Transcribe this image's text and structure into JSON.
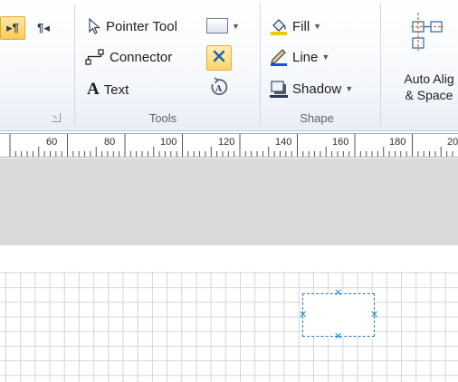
{
  "ribbon": {
    "paragraph": {
      "ltr_label": "▸¶",
      "rtl_label": "¶◂"
    },
    "tools": {
      "group_label": "Tools",
      "pointer_tool_label": "Pointer Tool",
      "connector_label": "Connector",
      "text_label": "Text"
    },
    "shape": {
      "group_label": "Shape",
      "fill_label": "Fill",
      "line_label": "Line",
      "shadow_label": "Shadow"
    },
    "arrange": {
      "auto_align_label_line1": "Auto Alig",
      "auto_align_label_line2": "& Space"
    }
  },
  "ruler": {
    "numbers": [
      "60",
      "80",
      "100",
      "120",
      "140",
      "160",
      "180",
      "20"
    ]
  },
  "colors": {
    "accent_highlight": "#ffd36b",
    "selection_handle": "#1b8fd6",
    "fill_swatch": "#f2c811",
    "line_swatch": "#1d4fd8"
  }
}
